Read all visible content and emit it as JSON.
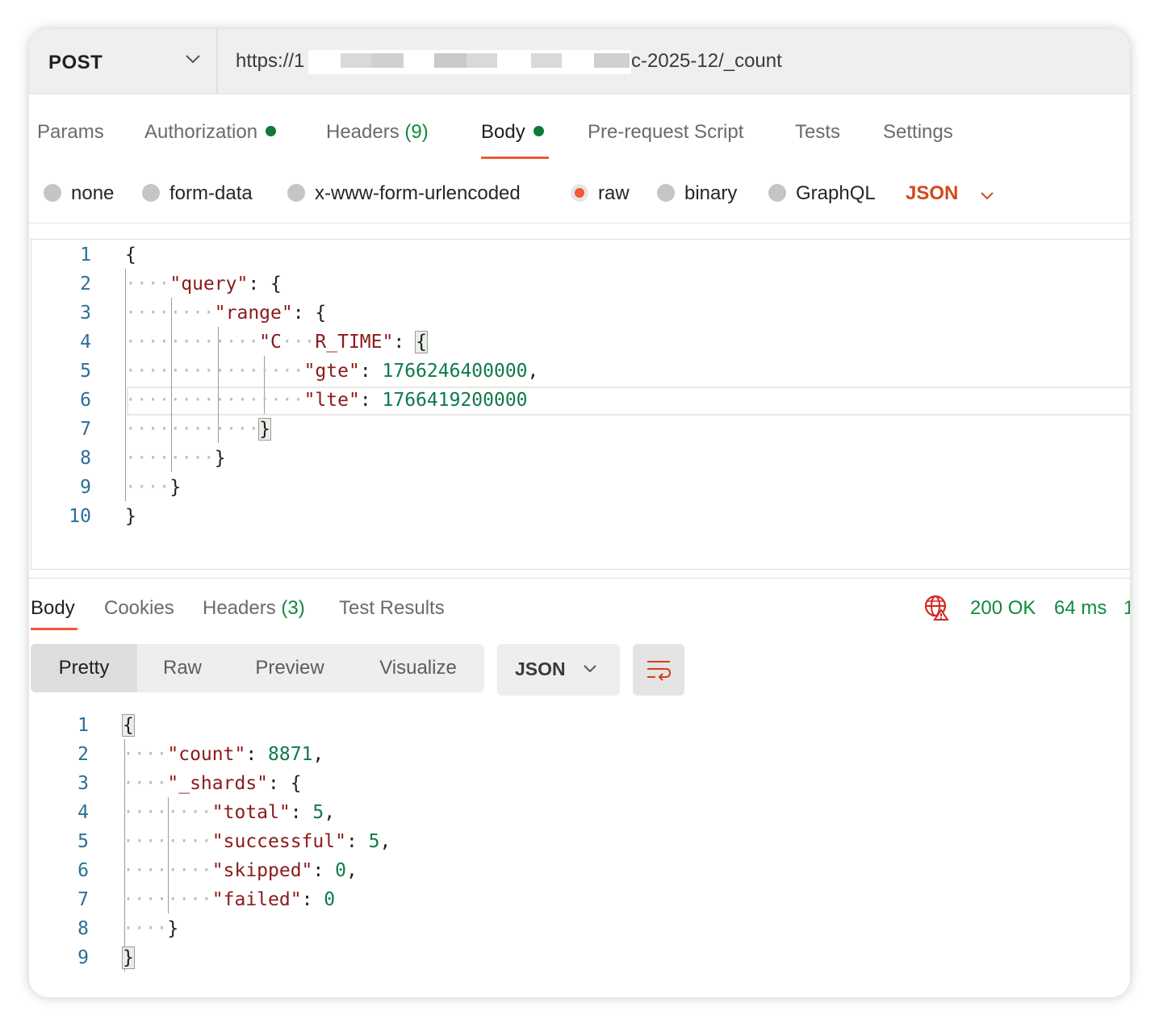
{
  "request": {
    "method": "POST",
    "url_prefix": "https://1",
    "url_suffix": "c-2025-12/_count"
  },
  "request_tabs": [
    {
      "label": "Params"
    },
    {
      "label": "Authorization"
    },
    {
      "label": "Headers",
      "count": "(9)"
    },
    {
      "label": "Body"
    },
    {
      "label": "Pre-request Script"
    },
    {
      "label": "Tests"
    },
    {
      "label": "Settings"
    }
  ],
  "body_types": [
    "none",
    "form-data",
    "x-www-form-urlencoded",
    "raw",
    "binary",
    "GraphQL"
  ],
  "body_type_selected": "raw",
  "body_format": "JSON",
  "request_body": {
    "line_numbers": [
      "1",
      "2",
      "3",
      "4",
      "5",
      "6",
      "7",
      "8",
      "9",
      "10"
    ],
    "lines": [
      "{",
      "\"query\": {",
      "\"range\": {",
      "\"C___R_TIME\": {",
      "\"gte\": 1766246400000,",
      "\"lte\": 1766419200000",
      "}",
      "}",
      "}",
      "}"
    ],
    "key_query": "\"query\"",
    "key_range": "\"range\"",
    "key_time_a": "\"C",
    "key_time_b": "R_TIME\"",
    "key_gte": "\"gte\"",
    "val_gte": "1766246400000",
    "key_lte": "\"lte\"",
    "val_lte": "1766419200000"
  },
  "response_tabs": [
    {
      "label": "Body"
    },
    {
      "label": "Cookies"
    },
    {
      "label": "Headers",
      "count": "(3)"
    },
    {
      "label": "Test Results"
    }
  ],
  "response_status": {
    "code": "200 OK",
    "time": "64 ms",
    "cut": "1"
  },
  "view_modes": [
    "Pretty",
    "Raw",
    "Preview",
    "Visualize"
  ],
  "view_mode_selected": "Pretty",
  "response_format": "JSON",
  "response_body": {
    "line_numbers": [
      "1",
      "2",
      "3",
      "4",
      "5",
      "6",
      "7",
      "8",
      "9"
    ],
    "key_count": "\"count\"",
    "val_count": "8871",
    "key_shards": "\"_shards\"",
    "key_total": "\"total\"",
    "val_total": "5",
    "key_successful": "\"successful\"",
    "val_successful": "5",
    "key_skipped": "\"skipped\"",
    "val_skipped": "0",
    "key_failed": "\"failed\"",
    "val_failed": "0"
  },
  "colors": {
    "accent": "#f05a35",
    "status_green": "#0f8a3c",
    "json_key": "#8b1a1a",
    "json_number": "#0e7a4a",
    "line_number": "#2a6f97"
  },
  "icons": [
    "chevron-down-icon",
    "globe-warning-icon",
    "wrap-lines-icon"
  ]
}
